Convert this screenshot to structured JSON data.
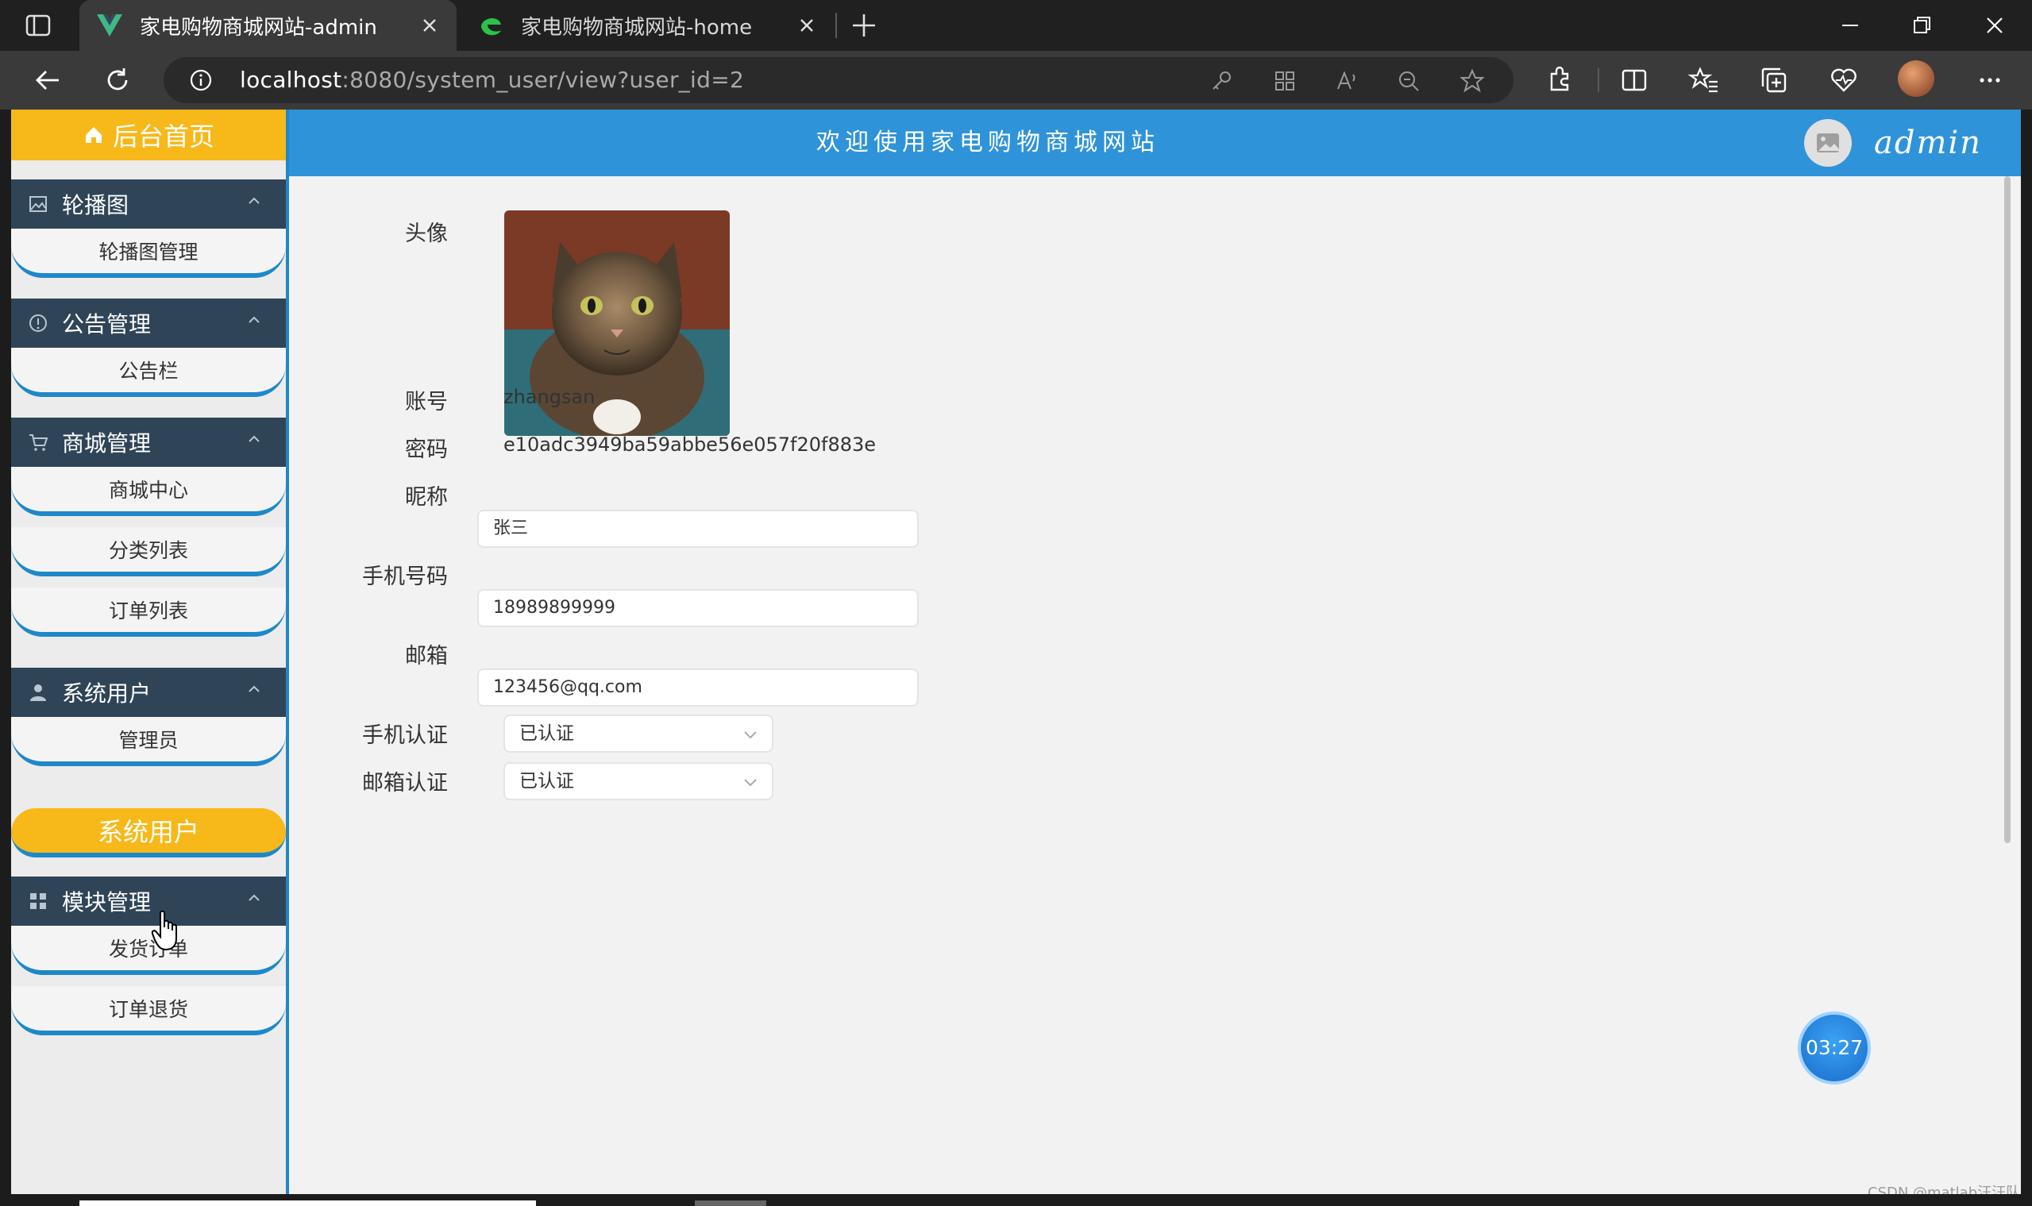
{
  "browser": {
    "tabs": [
      {
        "title": "家电购物商城网站-admin",
        "favicon": "vue-logo-icon",
        "active": true
      },
      {
        "title": "家电购物商城网站-home",
        "favicon": "edge-logo-icon",
        "active": false
      }
    ],
    "url_host": "localhost",
    "url_rest": ":8080/system_user/view?user_id=2"
  },
  "sidebar": {
    "home_label": "后台首页",
    "groups": [
      {
        "title": "轮播图",
        "icon": "image-icon",
        "items": [
          "轮播图管理"
        ]
      },
      {
        "title": "公告管理",
        "icon": "info-icon",
        "items": [
          "公告栏"
        ]
      },
      {
        "title": "商城管理",
        "icon": "cart-icon",
        "items": [
          "商城中心",
          "分类列表",
          "订单列表"
        ]
      },
      {
        "title": "系统用户",
        "icon": "user-icon",
        "items": [
          "管理员",
          "系统用户"
        ],
        "active_item": "系统用户"
      },
      {
        "title": "模块管理",
        "icon": "grid-icon",
        "items": [
          "发货订单",
          "订单退货"
        ]
      }
    ]
  },
  "header": {
    "welcome": "欢迎使用家电购物商城网站",
    "username": "admin"
  },
  "form": {
    "avatar_label": "头像",
    "account_label": "账号",
    "account_value": "zhangsan",
    "password_label": "密码",
    "password_value": "e10adc3949ba59abbe56e057f20f883e",
    "nickname_label": "昵称",
    "nickname_value": "张三",
    "phone_label": "手机号码",
    "phone_value": "18989899999",
    "email_label": "邮箱",
    "email_value": "123456@qq.com",
    "phone_verify_label": "手机认证",
    "phone_verify_value": "已认证",
    "email_verify_label": "邮箱认证",
    "email_verify_value": "已认证"
  },
  "overlay": {
    "timer": "03:27",
    "watermark": "CSDN @matlab汪汪队"
  },
  "colors": {
    "accent_blue": "#2f93d9",
    "accent_yellow": "#f7b81a",
    "sidebar_group": "#2f4457"
  }
}
